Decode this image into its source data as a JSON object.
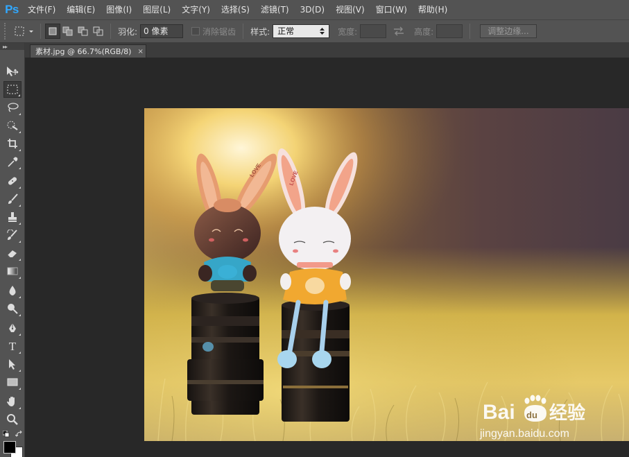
{
  "app": {
    "logo": "Ps",
    "accent": "#31a8ff"
  },
  "menu": [
    "文件(F)",
    "编辑(E)",
    "图像(I)",
    "图层(L)",
    "文字(Y)",
    "选择(S)",
    "滤镜(T)",
    "3D(D)",
    "视图(V)",
    "窗口(W)",
    "帮助(H)"
  ],
  "options": {
    "feather_label": "羽化:",
    "feather_value": "0 像素",
    "antialias_label": "消除锯齿",
    "style_label": "样式:",
    "style_value": "正常",
    "width_label": "宽度:",
    "height_label": "高度:",
    "refine_label": "调整边缘..."
  },
  "document": {
    "tab_title": "素材.jpg @ 66.7%(RGB/8)",
    "close_glyph": "×"
  },
  "tools": [
    {
      "icon": "move-icon"
    },
    {
      "icon": "rect-marquee-icon",
      "active": true
    },
    {
      "icon": "lasso-icon"
    },
    {
      "icon": "quick-select-icon"
    },
    {
      "icon": "crop-icon"
    },
    {
      "icon": "eyedropper-icon"
    },
    {
      "icon": "healing-brush-icon"
    },
    {
      "icon": "brush-icon"
    },
    {
      "icon": "clone-stamp-icon"
    },
    {
      "icon": "history-brush-icon"
    },
    {
      "icon": "eraser-icon"
    },
    {
      "icon": "gradient-icon"
    },
    {
      "icon": "blur-icon"
    },
    {
      "icon": "dodge-icon"
    },
    {
      "icon": "pen-icon"
    },
    {
      "icon": "type-icon",
      "glyph": "T"
    },
    {
      "icon": "path-select-icon"
    },
    {
      "icon": "rectangle-shape-icon"
    },
    {
      "icon": "hand-icon"
    },
    {
      "icon": "zoom-icon"
    }
  ],
  "watermark": {
    "brand_left": "Bai",
    "brand_paw": "du",
    "brand_right": "经验",
    "url": "jingyan.baidu.com"
  },
  "photo": {
    "left_bunny_text": "LOVE",
    "right_bunny_text": "LOVE"
  },
  "colors": {
    "foreground": "#000000",
    "background": "#ffffff"
  }
}
